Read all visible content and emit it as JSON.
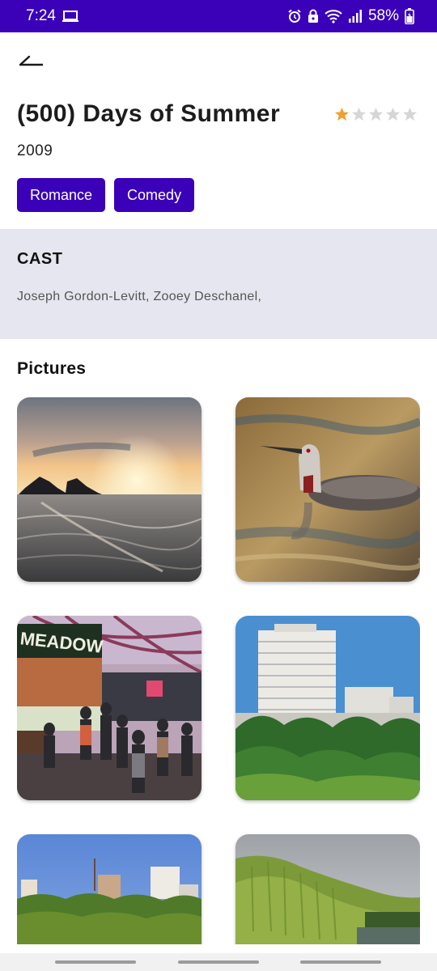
{
  "status_bar": {
    "time": "7:24",
    "battery": "58%",
    "icons": [
      "screen-record-icon",
      "alarm-icon",
      "lock-icon",
      "wifi-icon",
      "signal-icon",
      "battery-icon"
    ]
  },
  "movie": {
    "title": "(500) Days of Summer",
    "year": "2009",
    "rating": 1,
    "rating_max": 5,
    "genres": [
      "Romance",
      "Comedy"
    ]
  },
  "cast": {
    "heading": "CAST",
    "names": "Joseph Gordon-Levitt, Zooey Deschanel,"
  },
  "pictures": {
    "heading": "Pictures",
    "items": [
      "sunset-beach",
      "loon-bird",
      "meadow-market",
      "tower-forest",
      "city-trees",
      "willow-river"
    ]
  },
  "colors": {
    "accent": "#3a01b8",
    "cast_bg": "#e6e6f0",
    "star_filled": "#f0a030",
    "star_empty": "#d6d6d6"
  }
}
